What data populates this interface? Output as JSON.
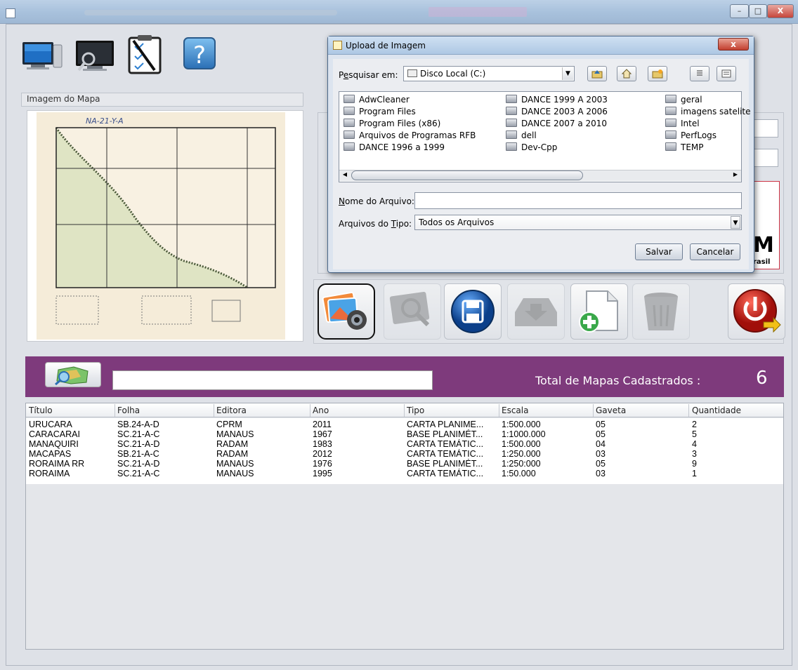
{
  "window": {
    "minimize_glyph": "–",
    "maximize_glyph": "□",
    "close_glyph": "X"
  },
  "toolbar": {
    "icons": [
      "monitor-icon",
      "monitor-search-icon",
      "checklist-icon",
      "help-icon"
    ],
    "help_glyph": "?"
  },
  "map_panel": {
    "label": "Imagem do Mapa",
    "sheet_code": "NA-21-Y-A"
  },
  "right_panel": {
    "logo_letter": "M",
    "logo_text": "rasil"
  },
  "actions": {
    "icons": [
      "photo-camera-icon",
      "zoom-icon",
      "save-icon",
      "download-icon",
      "add-file-icon",
      "trash-icon",
      "power-icon"
    ]
  },
  "search": {
    "value": "",
    "total_label": "Total de Mapas Cadastrados  :",
    "total_value": "6"
  },
  "table": {
    "columns": [
      "Título",
      "Folha",
      "Editora",
      "Ano",
      "Tipo",
      "Escala",
      "Gaveta",
      "Quantidade"
    ],
    "rows": [
      [
        "URUCARA",
        "SB.24-A-D",
        "CPRM",
        "2011",
        "CARTA PLANIME...",
        "1:500.000",
        "05",
        "2"
      ],
      [
        "CARACARAI",
        "SC.21-A-C",
        "MANAUS",
        "1967",
        "BASE PLANIMÉT...",
        "1:1000.000",
        "05",
        "5"
      ],
      [
        "MANAQUIRI",
        "SC.21-A-D",
        "RADAM",
        "1983",
        "CARTA TEMÁTIC...",
        "1:500.000",
        "04",
        "4"
      ],
      [
        "MACAPAS",
        "SB.21-A-C",
        "RADAM",
        "2012",
        "CARTA TEMÁTIC...",
        "1:250.000",
        "03",
        "3"
      ],
      [
        "RORAIMA RR",
        "SC.21-A-D",
        "MANAUS",
        "1976",
        "BASE PLANIMÉT...",
        "1:250:000",
        "05",
        "9"
      ],
      [
        "RORAIMA",
        "SC.21-A-C",
        "MANAUS",
        "1995",
        "CARTA TEMÁTIC...",
        "1:50.000",
        "03",
        "1"
      ]
    ]
  },
  "dialog": {
    "title": "Upload de Imagem",
    "close_glyph": "x",
    "lookin_label_mnemonic": "e",
    "lookin_label_pre": "P",
    "lookin_label_post": "squisar em:",
    "lookin_value": "Disco Local (C:)",
    "files": [
      [
        "AdwCleaner",
        "Program Files",
        "Program Files (x86)",
        "Arquivos de Programas RFB",
        "DANCE  1996 a 1999"
      ],
      [
        "DANCE  1999 A 2003",
        "DANCE  2003 A 2006",
        "DANCE  2007 a 2010",
        "dell",
        "Dev-Cpp"
      ],
      [
        "geral",
        "imagens satelite",
        "Intel",
        "PerfLogs",
        "TEMP"
      ]
    ],
    "filename_mnemonic": "N",
    "filename_label_post": "ome do Arquivo:",
    "filename_value": "",
    "filetype_label_pre": "Arquivos do ",
    "filetype_mnemonic": "T",
    "filetype_label_post": "ipo:",
    "filetype_value": "Todos os Arquivos",
    "save_label": "Salvar",
    "cancel_label": "Cancelar"
  },
  "colors": {
    "purple_bar": "#7e3a7c",
    "panel": "#dee1e7"
  }
}
